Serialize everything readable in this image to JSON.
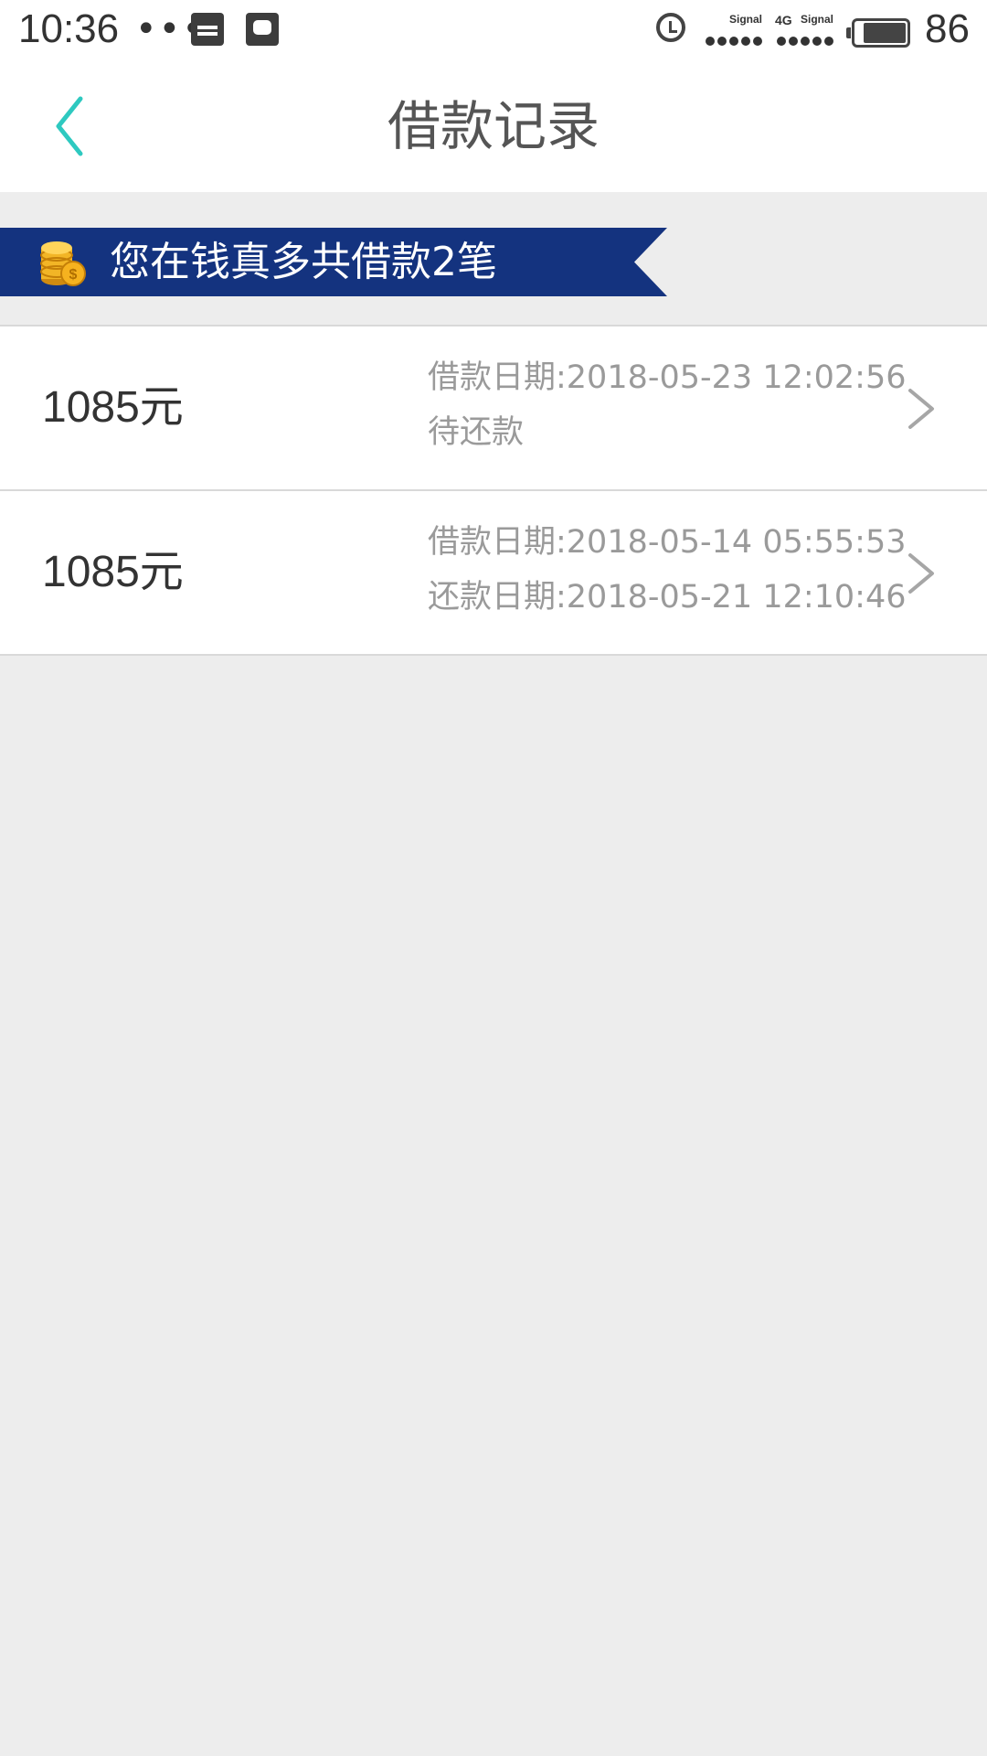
{
  "status_bar": {
    "time": "10:36",
    "dots": "•••",
    "signal1_label": "Signal",
    "signal2_label": "Signal",
    "network_type": "4G",
    "battery_level": "86",
    "battery_fraction": 0.86
  },
  "header": {
    "title": "借款记录",
    "back_icon": "chevron-left-icon",
    "back_color": "#2ec9c0"
  },
  "banner": {
    "text": "您在钱真多共借款2笔",
    "background": "#14337f",
    "icon": "coins-icon"
  },
  "records": [
    {
      "amount": "1085元",
      "line1": "借款日期:2018-05-23 12:02:56",
      "line2": "待还款"
    },
    {
      "amount": "1085元",
      "line1": "借款日期:2018-05-14 05:55:53",
      "line2": "还款日期:2018-05-21 12:10:46"
    }
  ]
}
